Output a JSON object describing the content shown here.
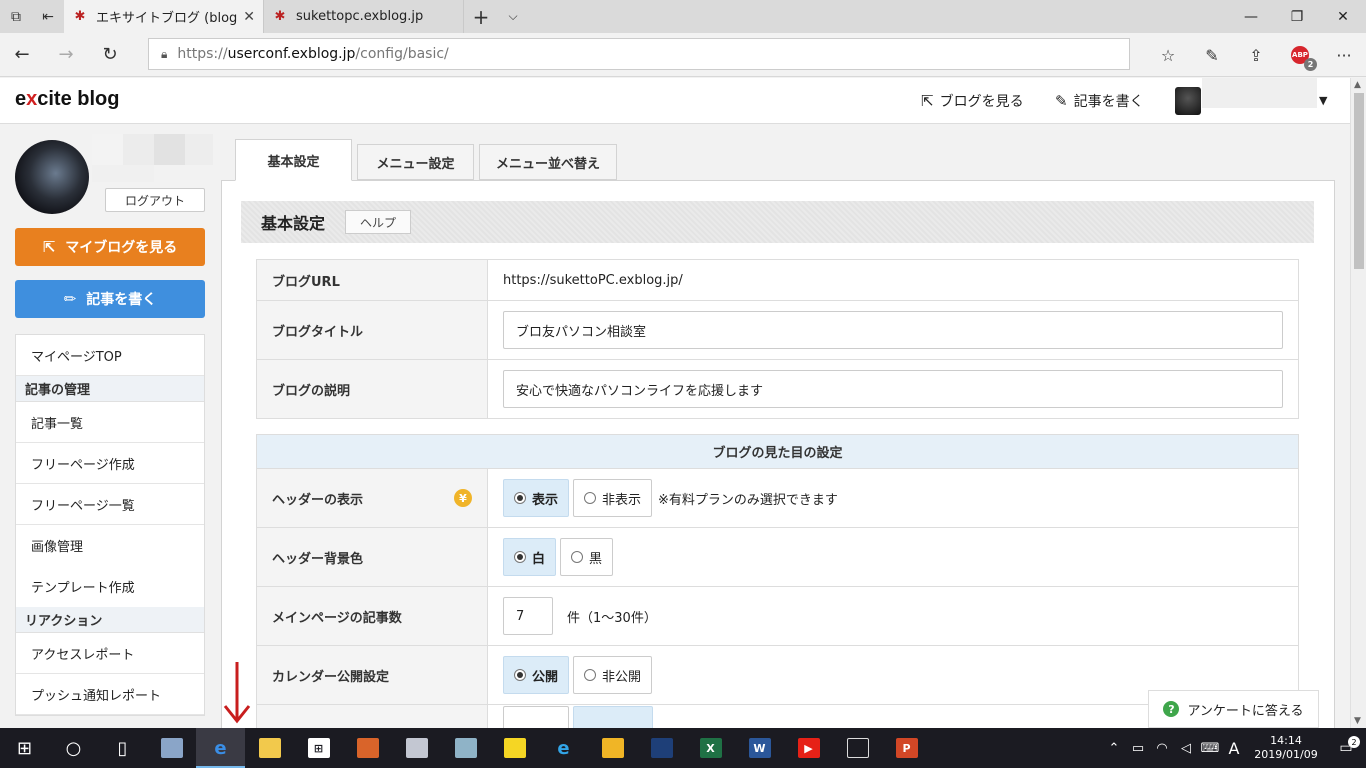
{
  "browser": {
    "tabs": [
      {
        "title": "エキサイトブログ (blog)|基本"
      },
      {
        "title": "sukettopc.exblog.jp"
      }
    ],
    "url_prefix": "https://",
    "url_domain": "userconf.exblog.jp",
    "url_path": "/config/basic/",
    "abp_label": "ABP",
    "abp_count": "2"
  },
  "site": {
    "logo_prefix": "e",
    "logo_x": "x",
    "logo_rest": "cite blog",
    "view_blog_link": "ブログを見る",
    "write_link": "記事を書く"
  },
  "sidebar": {
    "logout": "ログアウト",
    "my_blog_button": "マイブログを見る",
    "write_button": "記事を書く",
    "items": [
      {
        "type": "item",
        "label": "マイページTOP"
      },
      {
        "type": "head",
        "label": "記事の管理"
      },
      {
        "type": "item",
        "label": "記事一覧"
      },
      {
        "type": "item",
        "label": "フリーページ作成"
      },
      {
        "type": "item",
        "label": "フリーページ一覧"
      },
      {
        "type": "item",
        "label": "画像管理"
      },
      {
        "type": "item",
        "label": "テンプレート作成"
      },
      {
        "type": "head",
        "label": "リアクション"
      },
      {
        "type": "item",
        "label": "アクセスレポート"
      },
      {
        "type": "item",
        "label": "プッシュ通知レポート"
      }
    ]
  },
  "main": {
    "tabs": [
      "基本設定",
      "メニュー設定",
      "メニュー並べ替え"
    ],
    "section_title": "基本設定",
    "help_button": "ヘルプ",
    "blog_url_label": "ブログURL",
    "blog_url_value": "https://sukettoPC.exblog.jp/",
    "blog_title_label": "ブログタイトル",
    "blog_title_value": "ブロ友パソコン相談室",
    "blog_desc_label": "ブログの説明",
    "blog_desc_value": "安心で快適なパソコンライフを応援します",
    "appearance_caption": "ブログの見た目の設定",
    "header_display_label": "ヘッダーの表示",
    "header_display_options": [
      "表示",
      "非表示"
    ],
    "header_display_note": "※有料プランのみ選択できます",
    "yen_symbol": "¥",
    "header_bg_label": "ヘッダー背景色",
    "header_bg_options": [
      "白",
      "黒"
    ],
    "posts_count_label": "メインページの記事数",
    "posts_count_value": "7",
    "posts_count_unit": "件（1〜30件）",
    "calendar_label": "カレンダー公開設定",
    "calendar_options": [
      "公開",
      "非公開"
    ]
  },
  "survey_button": "アンケートに答える",
  "taskbar": {
    "time": "14:14",
    "date": "2019/01/09",
    "ime": "A",
    "notif_count": "2"
  }
}
